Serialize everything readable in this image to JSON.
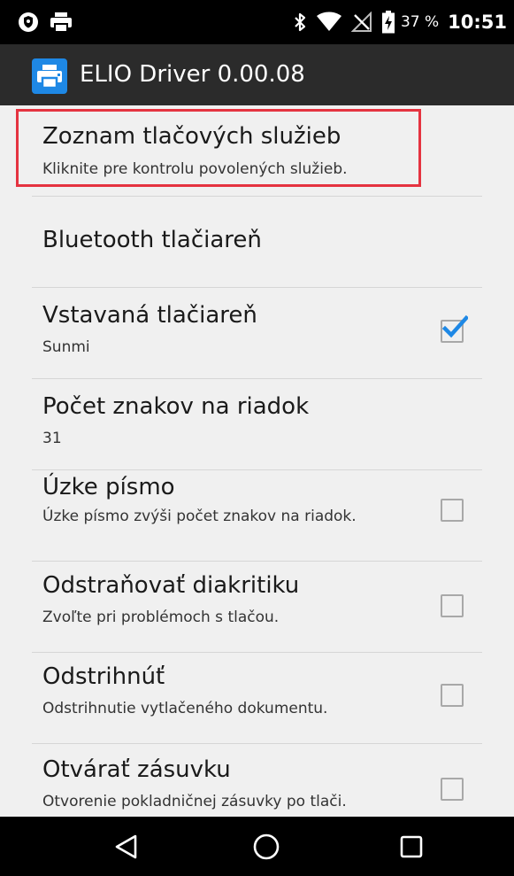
{
  "status_bar": {
    "battery_percent": "37 %",
    "time": "10:51",
    "icons": [
      "shield-icon",
      "print-notification-icon",
      "bluetooth-icon",
      "wifi-icon",
      "no-sim-icon",
      "battery-icon"
    ]
  },
  "app_bar": {
    "title": "ELIO Driver 0.00.08",
    "icon": "printer-app-icon"
  },
  "preferences": [
    {
      "title": "Zoznam tlačových služieb",
      "summary": "Kliknite pre kontrolu povolených služieb.",
      "highlighted": true
    },
    {
      "title": "Bluetooth tlačiareň",
      "summary": ""
    },
    {
      "title": "Vstavaná tlačiareň",
      "summary": "Sunmi",
      "checked": true
    },
    {
      "title": "Počet znakov na riadok",
      "summary": "31"
    },
    {
      "title": "Úzke písmo",
      "summary": "Úzke písmo zvýši počet znakov na riadok.",
      "checked": false
    },
    {
      "title": "Odstraňovať diakritiku",
      "summary": "Zvoľte pri problémoch s tlačou.",
      "checked": false
    },
    {
      "title": "Odstrihnúť",
      "summary": "Odstrihnutie vytlačeného dokumentu.",
      "checked": false
    },
    {
      "title": "Otvárať zásuvku",
      "summary": "Otvorenie pokladničnej zásuvky po tlači.",
      "checked": false
    }
  ],
  "nav_bar": {
    "buttons": [
      "back-icon",
      "home-icon",
      "recents-icon"
    ]
  },
  "colors": {
    "accent": "#1e88e5",
    "highlight": "#e53340",
    "app_bar": "#2b2b2b",
    "background": "#f0f0f0"
  }
}
